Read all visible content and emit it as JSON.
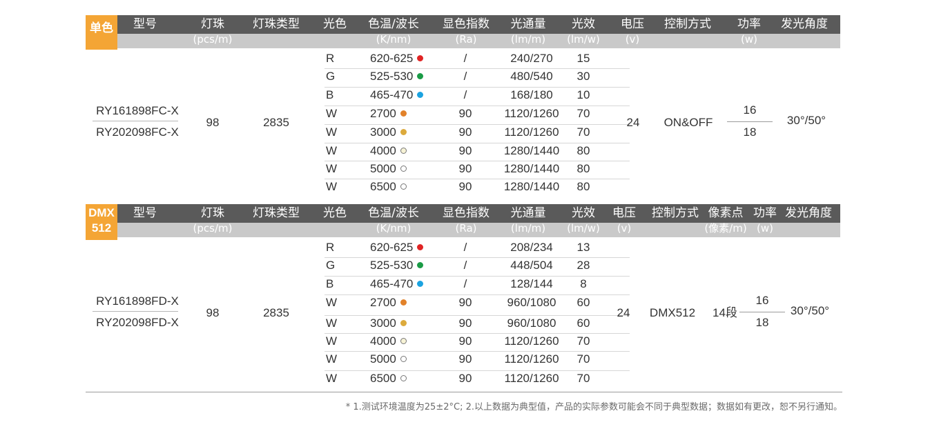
{
  "sections": [
    {
      "badge": [
        "单色"
      ],
      "headers": [
        {
          "main": "型号",
          "sub": ""
        },
        {
          "main": "灯珠",
          "sub": "(pcs/m)"
        },
        {
          "main": "灯珠类型",
          "sub": ""
        },
        {
          "main": "光色",
          "sub": ""
        },
        {
          "main": "色温/波长",
          "sub": "(K/nm)"
        },
        {
          "main": "显色指数",
          "sub": "(Ra)"
        },
        {
          "main": "光通量",
          "sub": "(lm/m)"
        },
        {
          "main": "光效",
          "sub": "(lm/w)"
        },
        {
          "main": "电压",
          "sub": "(v)"
        },
        {
          "main": "控制方式",
          "sub": ""
        },
        {
          "main": "功率",
          "sub": "(w)"
        },
        {
          "main": "发光角度",
          "sub": ""
        }
      ],
      "models": [
        "RY161898FC-X",
        "RY202098FC-X"
      ],
      "leds": "98",
      "led_type": "2835",
      "rows": [
        {
          "color": "R",
          "cct": "620-625",
          "dot": "#e02424",
          "cri": "/",
          "flux": "240/270",
          "eff": "15"
        },
        {
          "color": "G",
          "cct": "525-530",
          "dot": "#1a9b46",
          "cri": "/",
          "flux": "480/540",
          "eff": "30"
        },
        {
          "color": "B",
          "cct": "465-470",
          "dot": "#1ba3e0",
          "cri": "/",
          "flux": "168/180",
          "eff": "10"
        },
        {
          "color": "W",
          "cct": "2700",
          "dot": "#e2822a",
          "cri": "90",
          "flux": "1120/1260",
          "eff": "70"
        },
        {
          "color": "W",
          "cct": "3000",
          "dot": "#dcaa3c",
          "cri": "90",
          "flux": "1120/1260",
          "eff": "70"
        },
        {
          "color": "W",
          "cct": "4000",
          "dot": "#f7f3d6",
          "cri": "90",
          "flux": "1280/1440",
          "eff": "80"
        },
        {
          "color": "W",
          "cct": "5000",
          "dot": "#ffffff",
          "cri": "90",
          "flux": "1280/1440",
          "eff": "80"
        },
        {
          "color": "W",
          "cct": "6500",
          "dot": "#ffffff",
          "cri": "90",
          "flux": "1280/1440",
          "eff": "80"
        }
      ],
      "voltage": "24",
      "control": "ON&OFF",
      "pixel": "",
      "power": [
        "16",
        "18"
      ],
      "angle": "30°/50°"
    },
    {
      "badge": [
        "DMX",
        "512"
      ],
      "headers": [
        {
          "main": "型号",
          "sub": ""
        },
        {
          "main": "灯珠",
          "sub": "(pcs/m)"
        },
        {
          "main": "灯珠类型",
          "sub": ""
        },
        {
          "main": "光色",
          "sub": ""
        },
        {
          "main": "色温/波长",
          "sub": "(K/nm)"
        },
        {
          "main": "显色指数",
          "sub": "(Ra)"
        },
        {
          "main": "光通量",
          "sub": "(lm/m)"
        },
        {
          "main": "光效",
          "sub": "(lm/w)"
        },
        {
          "main": "电压",
          "sub": "(v)"
        },
        {
          "main": "控制方式",
          "sub": ""
        },
        {
          "main": "像素点",
          "sub": "(像素/m)"
        },
        {
          "main": "功率",
          "sub": "(w)"
        },
        {
          "main": "发光角度",
          "sub": ""
        }
      ],
      "models": [
        "RY161898FD-X",
        "RY202098FD-X"
      ],
      "leds": "98",
      "led_type": "2835",
      "rows": [
        {
          "color": "R",
          "cct": "620-625",
          "dot": "#e02424",
          "cri": "/",
          "flux": "208/234",
          "eff": "13"
        },
        {
          "color": "G",
          "cct": "525-530",
          "dot": "#1a9b46",
          "cri": "/",
          "flux": "448/504",
          "eff": "28"
        },
        {
          "color": "B",
          "cct": "465-470",
          "dot": "#1ba3e0",
          "cri": "/",
          "flux": "128/144",
          "eff": "8"
        },
        {
          "color": "W",
          "cct": "2700",
          "dot": "#e2822a",
          "cri": "90",
          "flux": "960/1080",
          "eff": "60"
        },
        {
          "color": "W",
          "cct": "3000",
          "dot": "#dcaa3c",
          "cri": "90",
          "flux": "960/1080",
          "eff": "60"
        },
        {
          "color": "W",
          "cct": "4000",
          "dot": "#f7f3d6",
          "cri": "90",
          "flux": "1120/1260",
          "eff": "70"
        },
        {
          "color": "W",
          "cct": "5000",
          "dot": "#ffffff",
          "cri": "90",
          "flux": "1120/1260",
          "eff": "70"
        },
        {
          "color": "W",
          "cct": "6500",
          "dot": "#ffffff",
          "cri": "90",
          "flux": "1120/1260",
          "eff": "70"
        }
      ],
      "voltage": "24",
      "control": "DMX512",
      "pixel": "14段",
      "power": [
        "16",
        "18"
      ],
      "angle": "30°/50°"
    }
  ],
  "footnote": "* 1.测试环境温度为25±2°C; 2.以上数据为典型值，产品的实际参数可能会不同于典型数据；数据如有更改，恕不另行通知。"
}
